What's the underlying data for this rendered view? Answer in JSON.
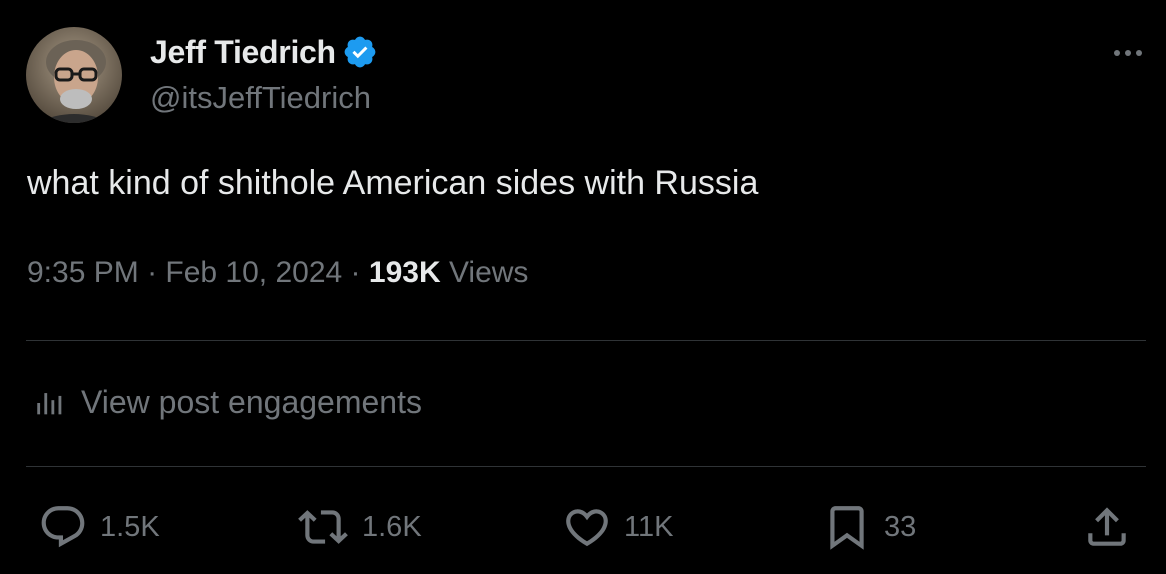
{
  "author": {
    "display_name": "Jeff Tiedrich",
    "handle": "@itsJeffTiedrich",
    "verified": true,
    "verified_color": "#1d9bf0"
  },
  "tweet": {
    "text": "what kind of shithole American sides with Russia",
    "time": "9:35 PM",
    "separator": " · ",
    "date": "Feb 10, 2024",
    "views_count": "193K",
    "views_label": " Views"
  },
  "engagements_link": {
    "icon": "analytics-icon",
    "label": "View post engagements"
  },
  "actions": {
    "reply": {
      "icon": "reply-icon",
      "count": "1.5K"
    },
    "repost": {
      "icon": "repost-icon",
      "count": "1.6K"
    },
    "like": {
      "icon": "like-icon",
      "count": "11K"
    },
    "bookmark": {
      "icon": "bookmark-icon",
      "count": "33"
    },
    "share": {
      "icon": "share-icon"
    }
  },
  "colors": {
    "background": "#000000",
    "primary_text": "#e7e9ea",
    "secondary_text": "#71767b",
    "divider": "#2f3336"
  }
}
